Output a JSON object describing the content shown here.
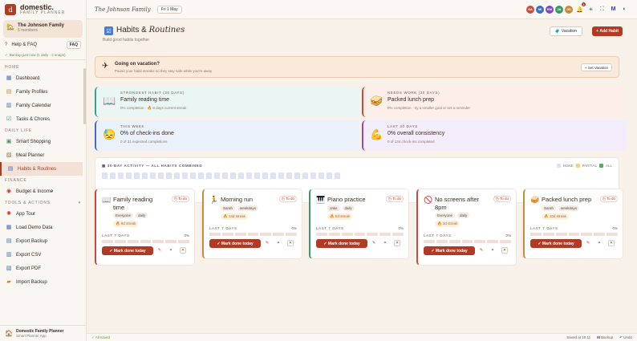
{
  "app": {
    "name": "domestic.",
    "tagline": "FAMILY PLANNER",
    "logo_letter": "d"
  },
  "family": {
    "name": "The Johnson Family",
    "members": "5 members"
  },
  "help": {
    "label": "Help & FAQ",
    "badge": "FAQ"
  },
  "backup_status": "Backup just now (1 daily · 2 snaps)",
  "nav": {
    "home_label": "HOME",
    "home": [
      {
        "label": "Dashboard",
        "icon": "dashboard-icon"
      },
      {
        "label": "Family Profiles",
        "icon": "profiles-icon"
      },
      {
        "label": "Family Calendar",
        "icon": "calendar-icon"
      },
      {
        "label": "Tasks & Chores",
        "icon": "tasks-icon"
      }
    ],
    "daily_label": "DAILY LIFE",
    "daily": [
      {
        "label": "Smart Shopping",
        "icon": "cart-icon"
      },
      {
        "label": "Meal Planner",
        "icon": "meal-icon"
      },
      {
        "label": "Habits & Routines",
        "icon": "habits-icon"
      }
    ],
    "finance_label": "FINANCE",
    "finance": [
      {
        "label": "Budget & Income",
        "icon": "budget-icon"
      }
    ],
    "tools_label": "TOOLS & ACTIONS",
    "tools": [
      {
        "label": "App Tour",
        "icon": "tour-icon"
      },
      {
        "label": "Load Demo Data",
        "icon": "demo-data-icon"
      },
      {
        "label": "Export Backup",
        "icon": "export-backup-icon"
      },
      {
        "label": "Export CSV",
        "icon": "csv-icon"
      },
      {
        "label": "Export PDF",
        "icon": "pdf-icon"
      },
      {
        "label": "Import Backup",
        "icon": "import-icon"
      }
    ]
  },
  "side_footer": {
    "title": "Domestic Family Planner",
    "subtitle": "Smart Planner App"
  },
  "topbar": {
    "title": "The Johnson Family",
    "date": "Fri 1 May",
    "avatars": [
      {
        "initials": "SA",
        "color": "#c8503a"
      },
      {
        "initials": "MI",
        "color": "#3a6ec8"
      },
      {
        "initials": "EM",
        "color": "#7a4ac0"
      },
      {
        "initials": "JA",
        "color": "#3a9a6a"
      },
      {
        "initials": "JO",
        "color": "#c88a3a"
      }
    ],
    "notification_count": "4"
  },
  "page": {
    "title_a": "Habits &",
    "title_b": "Routines",
    "subtitle": "Build good habits together",
    "vacation_btn": "Vacation",
    "add_btn": "+ Add Habit"
  },
  "vacation": {
    "title": "Going on vacation?",
    "subtitle": "Pause your habit streaks so they stay safe while you're away",
    "button": "+ Set Vacation"
  },
  "stats": [
    {
      "label": "STRONGEST HABIT (30 DAYS)",
      "value": "Family reading time",
      "sub": "0% completion · 🔥 8 days current streak",
      "icon": "📖",
      "color": "#3aa090",
      "bg": "#eaf6f3"
    },
    {
      "label": "NEEDS WORK (30 DAYS)",
      "value": "Packed lunch prep",
      "sub": "0% completion · try a smaller goal or set a reminder",
      "icon": "🥪",
      "color": "#c84a3a",
      "bg": "#fcefea"
    },
    {
      "label": "THIS WEEK",
      "value": "0% of check-ins done",
      "sub": "0 of 31 expected completions",
      "icon": "😓",
      "color": "#3a6ec8",
      "bg": "#eaf1fb"
    },
    {
      "label": "LAST 30 DAYS",
      "value": "0% overall consistency",
      "sub": "0 of 134 check-ins completed",
      "icon": "💪",
      "color": "#8a4ac0",
      "bg": "#f3ecfa"
    }
  ],
  "activity": {
    "title": "30-DAY ACTIVITY — ALL HABITS COMBINED",
    "legend_none": "NONE",
    "legend_partial": "PARTIAL",
    "legend_all": "ALL",
    "days": 30
  },
  "habits": [
    {
      "name": "Family reading time",
      "icon": "📖",
      "status": "To do",
      "tags": [
        "Everyone",
        "daily"
      ],
      "streak": "🔥 8d streak",
      "last": "LAST 7 DAYS",
      "pct": "0%",
      "mark": "✓ Mark done today",
      "color": "#c84a3a",
      "lines": 2
    },
    {
      "name": "Morning run",
      "icon": "🏃",
      "status": "To do",
      "tags": [
        "Sarah",
        "weekdays"
      ],
      "streak": "🔥 14d streak",
      "last": "LAST 7 DAYS",
      "pct": "0%",
      "mark": "✓ Mark done today",
      "color": "#c88a3a",
      "lines": 1
    },
    {
      "name": "Piano practice",
      "icon": "🎹",
      "status": "To do",
      "tags": [
        "Jake",
        "daily"
      ],
      "streak": "🔥 5d streak",
      "last": "LAST 7 DAYS",
      "pct": "0%",
      "mark": "✓ Mark done today",
      "color": "#3a9a6a",
      "lines": 1
    },
    {
      "name": "No screens after 8pm",
      "icon": "🚫",
      "status": "To do",
      "tags": [
        "Everyone",
        "daily"
      ],
      "streak": "🔥 3d streak",
      "last": "LAST 7 DAYS",
      "pct": "0%",
      "mark": "✓ Mark done today",
      "color": "#c84a3a",
      "lines": 2
    },
    {
      "name": "Packed lunch prep",
      "icon": "🥪",
      "status": "To do",
      "tags": [
        "Sarah",
        "weekdays"
      ],
      "streak": "🔥 10d streak",
      "last": "LAST 7 DAYS",
      "pct": "0%",
      "mark": "✓ Mark done today",
      "color": "#c88a3a",
      "lines": 1
    }
  ],
  "footer": {
    "saved": "✓ All saved",
    "time": "Saved at 10:11",
    "backup": "Backup",
    "undo": "Undo"
  }
}
